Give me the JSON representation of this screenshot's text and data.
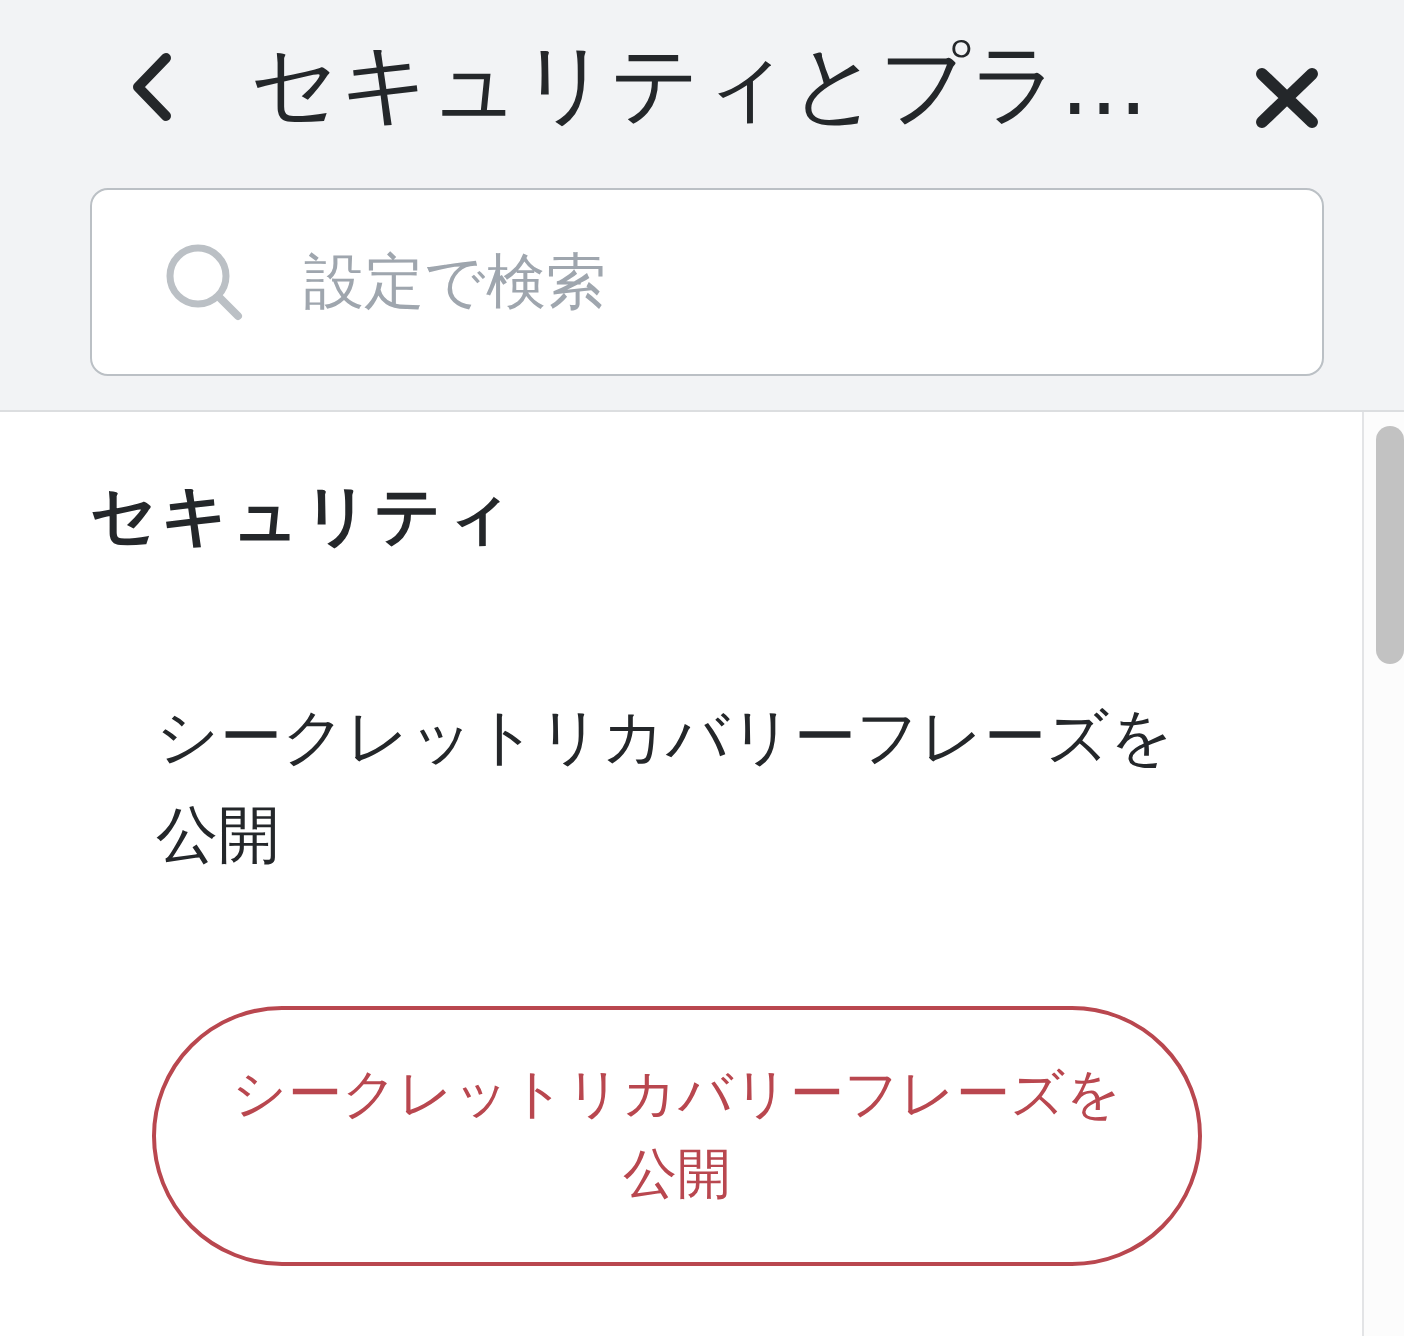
{
  "header": {
    "title": "セキュリティとプラ…"
  },
  "search": {
    "placeholder": "設定で検索"
  },
  "section": {
    "heading": "セキュリティ",
    "description": "シークレットリカバリーフレーズを公開",
    "button": "シークレットリカバリーフレーズを公開"
  }
}
